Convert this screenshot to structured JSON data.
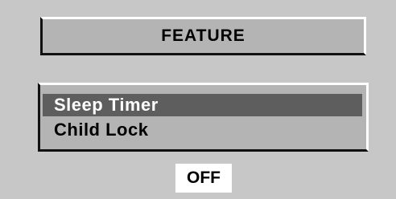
{
  "header": {
    "title": "FEATURE"
  },
  "menu": {
    "items": [
      {
        "label": "Sleep Timer",
        "selected": true
      },
      {
        "label": "Child Lock",
        "selected": false
      }
    ]
  },
  "status": {
    "value": "OFF"
  },
  "colors": {
    "background": "#c7c7c7",
    "panel": "#b4b4b4",
    "highlight": "#5e5e5e",
    "highlight_text": "#ffffff",
    "text": "#000000"
  }
}
